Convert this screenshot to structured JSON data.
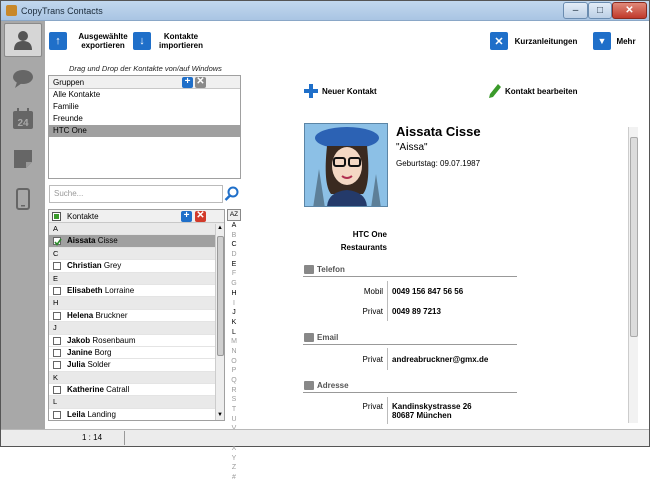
{
  "window": {
    "title": "CopyTrans Contacts",
    "min": "–",
    "max": "□",
    "close": "✕"
  },
  "sidebar": {
    "items": [
      {
        "name": "contacts",
        "icon": "person-icon"
      },
      {
        "name": "messages",
        "icon": "chat-bubble-icon"
      },
      {
        "name": "calendar",
        "icon": "calendar-icon",
        "text": "24"
      },
      {
        "name": "notes",
        "icon": "note-icon"
      },
      {
        "name": "device",
        "icon": "phone-icon"
      }
    ]
  },
  "toolbar": {
    "export_label": "Ausgewählte exportieren",
    "import_label": "Kontakte importieren",
    "guides_label": "Kurzanleitungen",
    "more_label": "Mehr"
  },
  "groups": {
    "hint": "Drag und Drop der Kontakte von/auf Windows",
    "header": "Gruppen",
    "add": "+",
    "remove": "✕",
    "items": [
      "Alle Kontakte",
      "Familie",
      "Freunde",
      "HTC One"
    ],
    "selected": "HTC One"
  },
  "search": {
    "placeholder": "Suche..."
  },
  "contacts": {
    "header": "Kontakte",
    "add": "+",
    "remove": "✕",
    "rows": [
      {
        "type": "letter",
        "text": "A"
      },
      {
        "type": "contact",
        "first": "Aissata",
        "last": "Cisse",
        "checked": true,
        "selected": true
      },
      {
        "type": "letter",
        "text": "C"
      },
      {
        "type": "contact",
        "first": "Christian",
        "last": "Grey"
      },
      {
        "type": "letter",
        "text": "E"
      },
      {
        "type": "contact",
        "first": "Elisabeth",
        "last": "Lorraine"
      },
      {
        "type": "letter",
        "text": "H"
      },
      {
        "type": "contact",
        "first": "Helena",
        "last": "Bruckner"
      },
      {
        "type": "letter",
        "text": "J"
      },
      {
        "type": "contact",
        "first": "Jakob",
        "last": "Rosenbaum"
      },
      {
        "type": "contact",
        "first": "Janine",
        "last": "Borg"
      },
      {
        "type": "contact",
        "first": "Julia",
        "last": "Solder"
      },
      {
        "type": "letter",
        "text": "K"
      },
      {
        "type": "contact",
        "first": "Katherine",
        "last": "Catrall"
      },
      {
        "type": "letter",
        "text": "L"
      },
      {
        "type": "contact",
        "first": "Leila",
        "last": "Landing"
      }
    ]
  },
  "alphabet": {
    "sort_label": "AZ",
    "letters": [
      "A",
      "B",
      "C",
      "D",
      "E",
      "F",
      "G",
      "H",
      "I",
      "J",
      "K",
      "L",
      "M",
      "N",
      "O",
      "P",
      "Q",
      "R",
      "S",
      "T",
      "U",
      "V",
      "W",
      "X",
      "Y",
      "Z",
      "#"
    ],
    "active": [
      "A",
      "C",
      "E",
      "H",
      "J",
      "K",
      "L"
    ]
  },
  "actions": {
    "new_contact": "Neuer Kontakt",
    "edit_contact": "Kontakt bearbeiten"
  },
  "detail": {
    "name": "Aissata Cisse",
    "nickname": "\"Aissa\"",
    "birthday": "Geburtstag: 09.07.1987",
    "groups": [
      "HTC One",
      "Restaurants"
    ],
    "phone": {
      "title": "Telefon",
      "fields": [
        {
          "label": "Mobil",
          "value": "0049 156 847 56 56"
        },
        {
          "label": "Privat",
          "value": "0049 89 7213"
        }
      ]
    },
    "email": {
      "title": "Email",
      "fields": [
        {
          "label": "Privat",
          "value": "andreabruckner@gmx.de"
        }
      ]
    },
    "address": {
      "title": "Adresse",
      "fields": [
        {
          "label": "Privat",
          "line1": "Kandinskystrasse 26",
          "line2": "80687 München"
        }
      ]
    }
  },
  "status": {
    "count": "1 : 14"
  },
  "colors": {
    "accent_blue": "#1f6fc9",
    "remove_red": "#d23a2a",
    "selection_gray": "#a0a0a0",
    "sidebar_gray": "#a8a8a8"
  }
}
